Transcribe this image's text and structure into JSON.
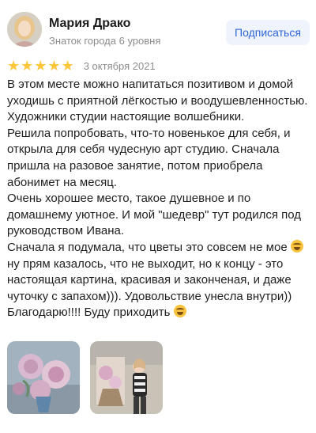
{
  "author": {
    "name": "Мария Драко",
    "level": "Знаток города 6 уровня"
  },
  "subscribe_label": "Подписаться",
  "review": {
    "rating_stars": 5,
    "star_glyph": "★",
    "date": "3 октября 2021",
    "text_part1": "В этом месте можно напитаться позитивом и домой уходишь с приятной лёгкостью и воодушевленностью. Художники студии настоящие волшебники.\nРешила попробовать, что-то новенькое для себя, и открыла для себя чудесную арт студию. Сначала пришла на разовое занятие, потом приобрела абонимет на месяц.\nОчень хорошее место, такое душевное и по домашнему уютное. И мой \"шедевр\" тут родился под руководством Ивана.\nСначала я подумала, что цветы это совсем не мое ",
    "text_part2": " ну прям казалось, что не выходит, но к концу - это настоящая картина, красивая и законченая, и даже чуточку с запахом))). Удовольствие унесла внутри)) Благодарю!!!! Буду приходить",
    "emoji_name": "grinning-sweat-emoji"
  },
  "colors": {
    "star": "#fdc63d",
    "subscribe_bg": "#eef3fc",
    "subscribe_text": "#2f64d8",
    "secondary_text": "#8c8c8c"
  },
  "photos": [
    {
      "icon": "peony-painting-photo"
    },
    {
      "icon": "woman-with-painting-photo"
    }
  ]
}
